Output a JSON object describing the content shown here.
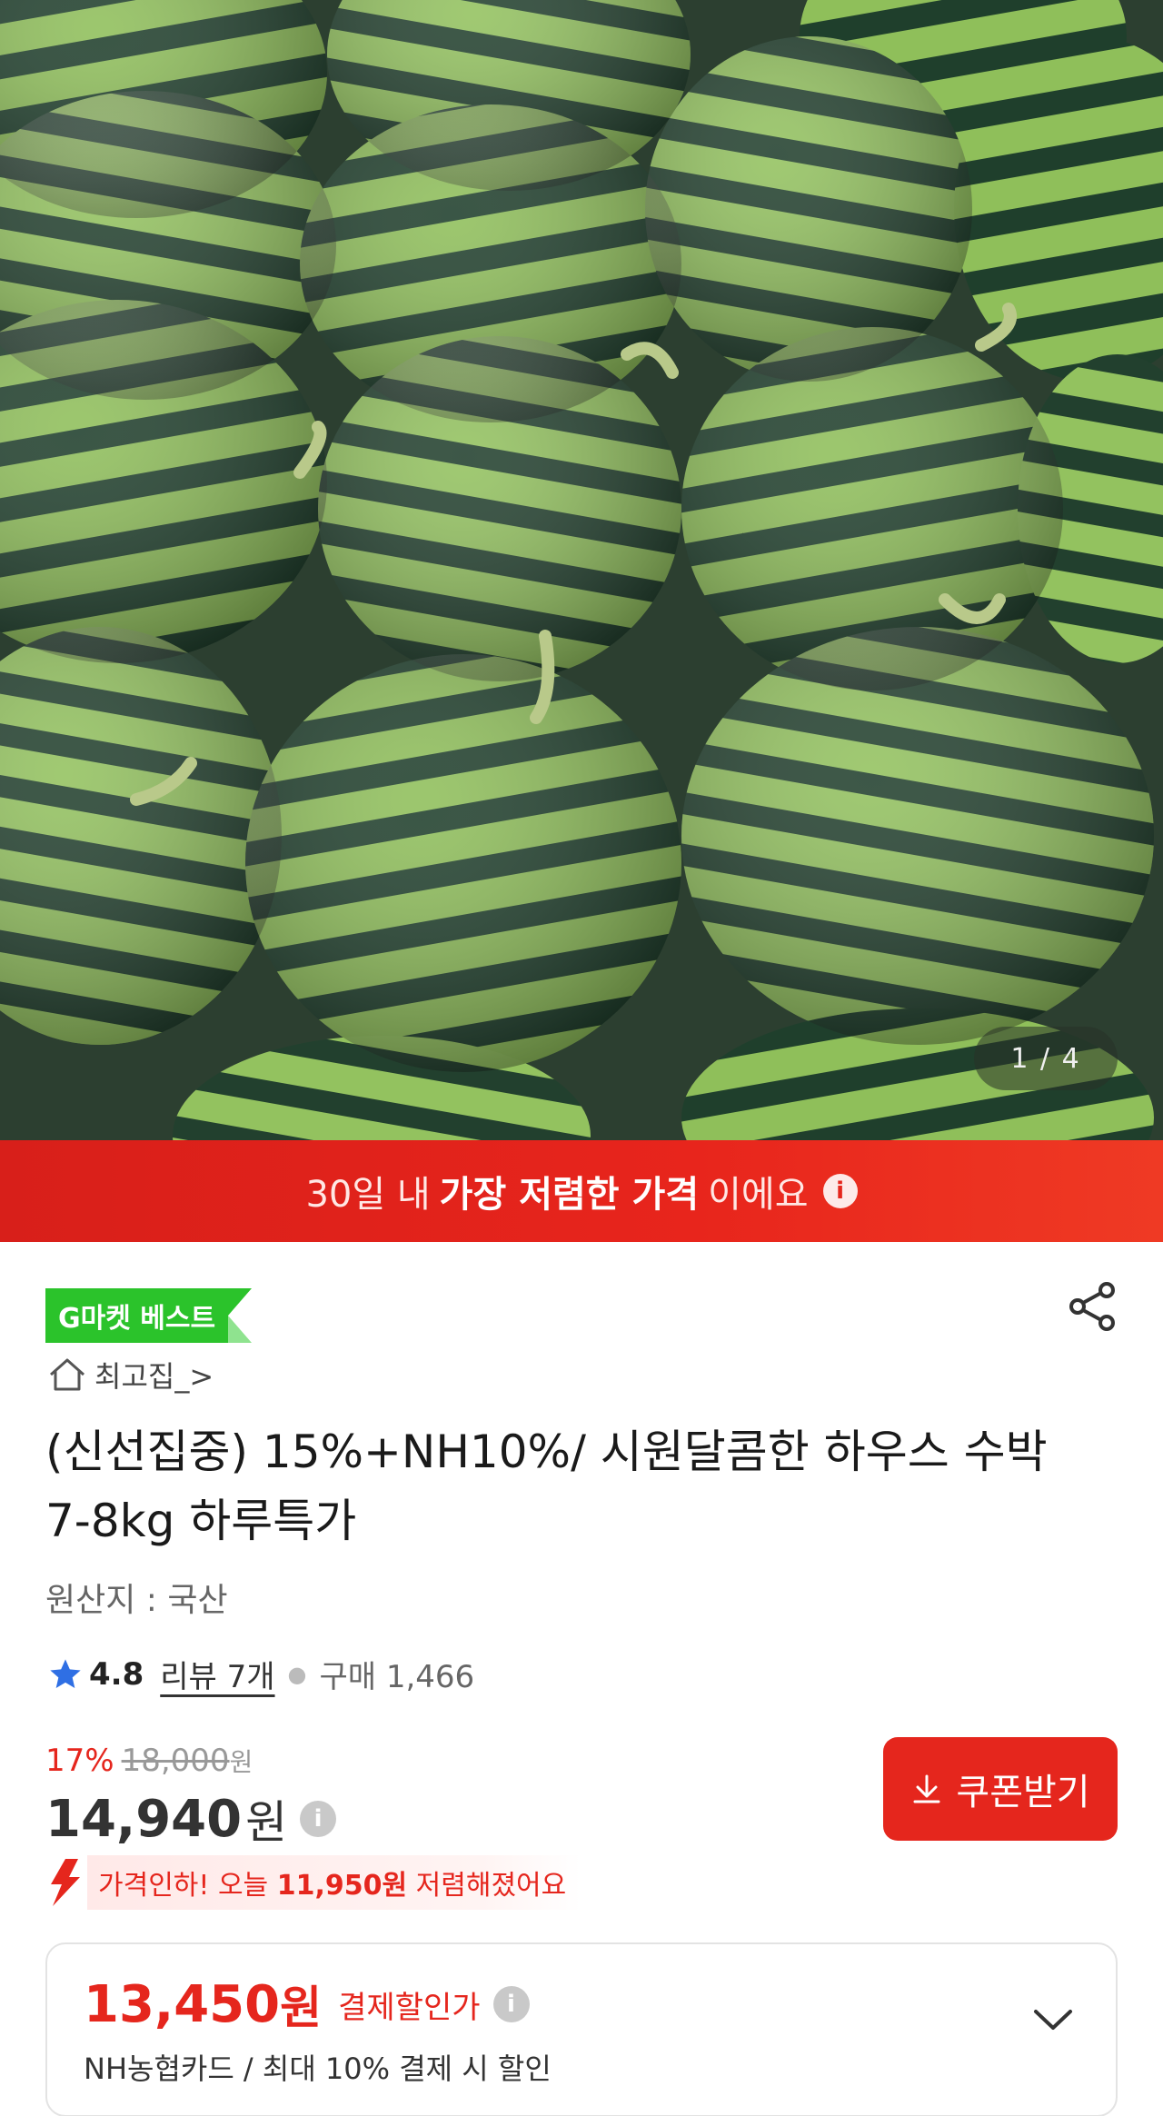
{
  "hero": {
    "pager": "1 / 4"
  },
  "banner": {
    "pre": "30일 내",
    "bold": "가장 저렴한 가격",
    "post": "이에요",
    "info_icon": "info-icon"
  },
  "product": {
    "badge": "G마켓 베스트",
    "store": "최고집_>",
    "title": "(신선집중) 15%+NH10%/ 시원달콤한 하우스 수박 7-8kg 하루특가",
    "origin": "원산지 : 국산",
    "rating": "4.8",
    "reviews": "리뷰 7개",
    "purchase": "구매 1,466"
  },
  "price": {
    "discount_pct": "17%",
    "original": "18,000",
    "original_unit": "원",
    "current": "14,940",
    "current_unit": "원",
    "coupon_button": "쿠폰받기",
    "drop_pre": "가격인하! 오늘",
    "drop_amount": "11,950원",
    "drop_post": "저렴해졌어요"
  },
  "payment": {
    "price": "13,450",
    "unit": "원",
    "label": "결제할인가",
    "sub": "NH농협카드 / 최대 10% 결제 시 할인"
  },
  "colors": {
    "accent": "#e5261d",
    "badge_green": "#2bc32b"
  }
}
